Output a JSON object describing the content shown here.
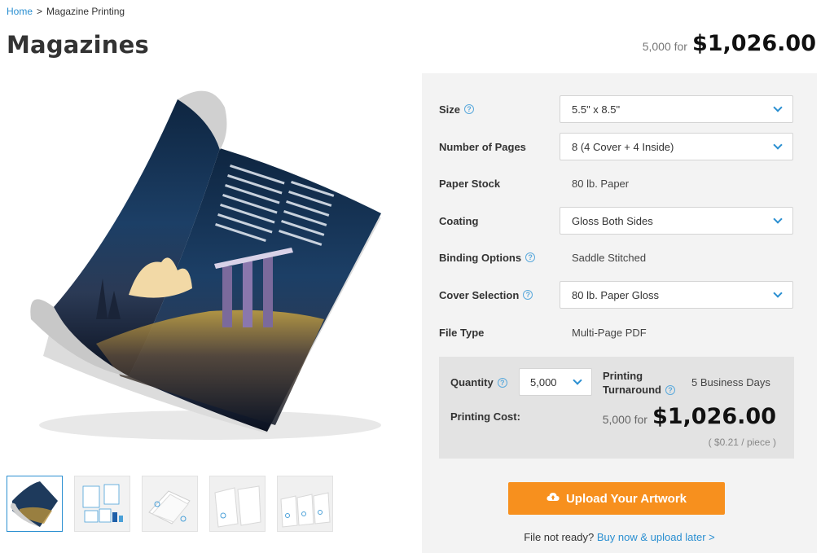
{
  "breadcrumb": {
    "home": "Home",
    "separator": ">",
    "current": "Magazine Printing"
  },
  "page": {
    "title": "Magazines"
  },
  "header_price": {
    "qty": "5,000 for",
    "amount": "$1,026.00"
  },
  "options": [
    {
      "label": "Size",
      "help": true,
      "type": "select",
      "value": "5.5\" x 8.5\""
    },
    {
      "label": "Number of Pages",
      "help": false,
      "type": "select",
      "value": "8 (4 Cover + 4 Inside)"
    },
    {
      "label": "Paper Stock",
      "help": false,
      "type": "static",
      "value": "80 lb. Paper"
    },
    {
      "label": "Coating",
      "help": false,
      "type": "select",
      "value": "Gloss Both Sides"
    },
    {
      "label": "Binding Options",
      "help": true,
      "type": "static",
      "value": "Saddle Stitched"
    },
    {
      "label": "Cover Selection",
      "help": true,
      "type": "select",
      "value": "80 lb. Paper Gloss"
    },
    {
      "label": "File Type",
      "help": false,
      "type": "static",
      "value": "Multi-Page PDF"
    }
  ],
  "cost": {
    "quantity_label": "Quantity",
    "quantity_value": "5,000",
    "turnaround_label_1": "Printing",
    "turnaround_label_2": "Turnaround",
    "turnaround_value": "5 Business Days",
    "printing_cost_label": "Printing Cost:",
    "qty": "5,000 for",
    "amount": "$1,026.00",
    "unit": "( $0.21 / piece )"
  },
  "upload_button": {
    "label": "Upload Your Artwork",
    "icon": "cloud-upload-icon"
  },
  "not_ready": {
    "text": "File not ready?",
    "link": "Buy now & upload later >"
  },
  "colors": {
    "accent": "#f7901e",
    "link": "#2a8fd1",
    "panel": "#f3f3f3"
  },
  "thumbnails": [
    "magazine-photo",
    "size-diagram",
    "number-of-pages",
    "coating",
    "cover-selection"
  ]
}
